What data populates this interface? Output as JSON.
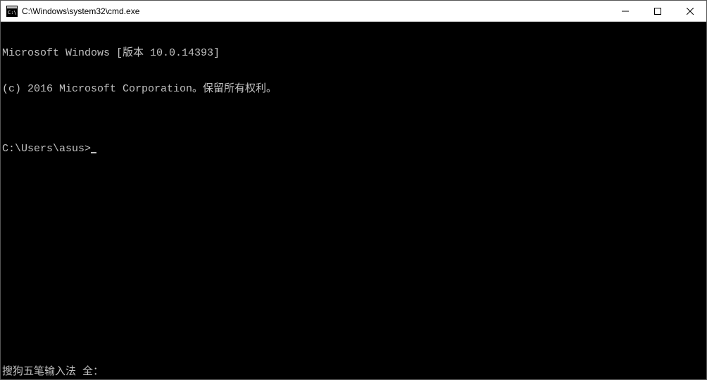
{
  "window": {
    "title": "C:\\Windows\\system32\\cmd.exe"
  },
  "terminal": {
    "line1": "Microsoft Windows [版本 10.0.14393]",
    "line2": "(c) 2016 Microsoft Corporation。保留所有权利。",
    "blank": "",
    "prompt": "C:\\Users\\asus>"
  },
  "ime": {
    "status": "搜狗五笔输入法 全："
  }
}
